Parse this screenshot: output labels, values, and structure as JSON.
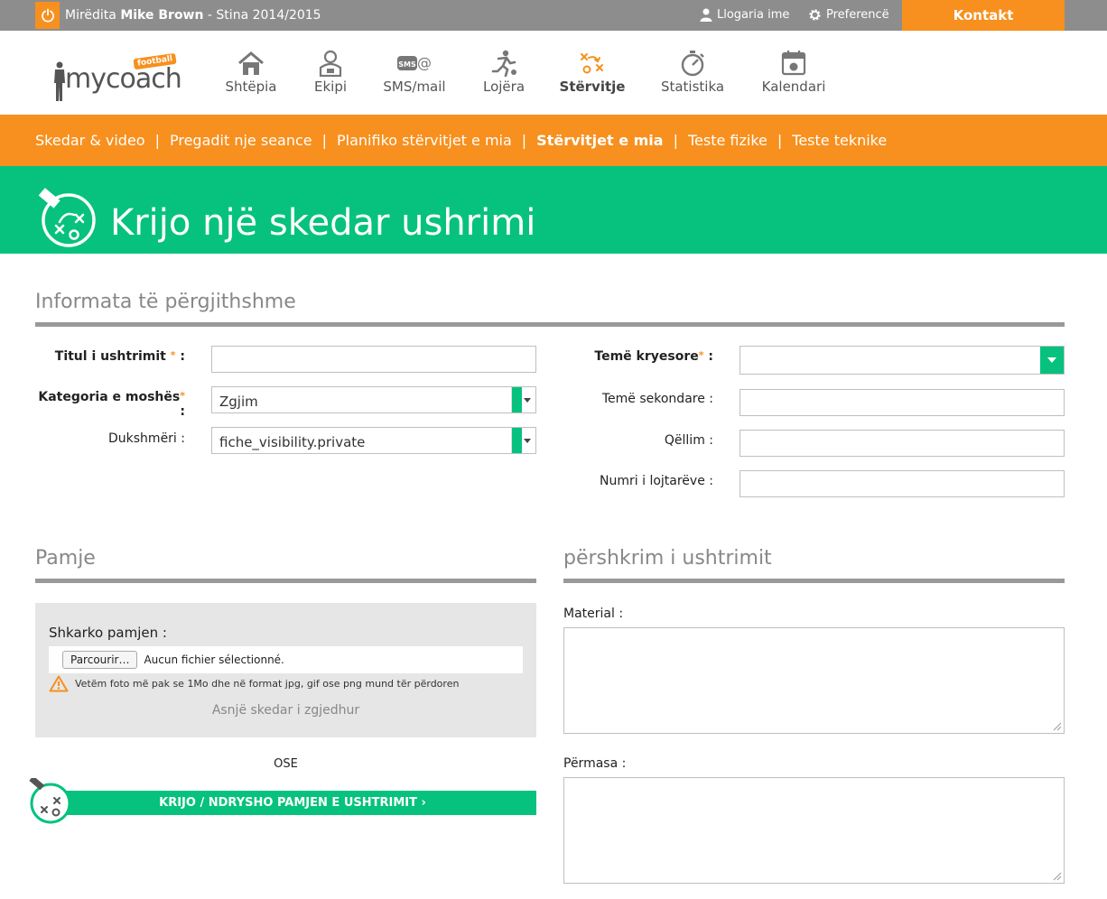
{
  "topbar": {
    "greeting_prefix": "Mirëdita",
    "user_name": "Mike Brown",
    "season": "- Stina 2014/2015",
    "account_label": "Llogaria ime",
    "preferences_label": "Preferencë",
    "contact_label": "Kontakt"
  },
  "logo": {
    "text": "mycoach",
    "badge": "football"
  },
  "nav": {
    "items": [
      {
        "label": "Shtëpia",
        "icon": "home-icon"
      },
      {
        "label": "Ekipi",
        "icon": "team-icon"
      },
      {
        "label": "SMS/mail",
        "icon": "sms-mail-icon"
      },
      {
        "label": "Lojëra",
        "icon": "games-icon"
      },
      {
        "label": "Stërvitje",
        "icon": "training-icon"
      },
      {
        "label": "Statistika",
        "icon": "statistics-icon"
      },
      {
        "label": "Kalendari",
        "icon": "calendar-icon"
      }
    ]
  },
  "subnav": {
    "items": [
      "Skedar & video",
      "Pregadit nje seance",
      "Planifiko stërvitjet e mia",
      "Stërvitjet e mia",
      "Teste fizike",
      "Teste teknike"
    ],
    "separator": "|"
  },
  "hero": {
    "title": "Krijo një skedar ushrimi"
  },
  "general": {
    "title": "Informata të përgjithshme",
    "exercise_title_label": "Titul i ushtrimit",
    "age_category_label": "Kategoria e moshës",
    "visibility_label": "Dukshmëri :",
    "age_category_value": "Zgjim",
    "visibility_value": "fiche_visibility.private",
    "main_theme_label": "Temë kryesore",
    "secondary_theme_label": "Temë sekondare :",
    "goal_label": "Qëllim :",
    "players_label": "Numri i lojtarëve :",
    "required_mark": "*",
    "colon": ":"
  },
  "view": {
    "title": "Pamje",
    "upload_label": "Shkarko pamjen :",
    "browse_label": "Parcourir…",
    "no_file_selected": "Aucun fichier sélectionné.",
    "warning": "Vetëm foto më pak se 1Mo dhe në format jpg, gif ose png mund tër përdoren",
    "no_file_chosen": "Asnjë skedar i zgjedhur",
    "or_label": "OSE",
    "create_button": "KRIJO / NDRYSHO PAMJEN E USHTRIMIT ›"
  },
  "description": {
    "title": "përshkrim i ushtrimit",
    "material_label": "Material :",
    "dimensions_label": "Përmasa :"
  },
  "colors": {
    "orange": "#f7901e",
    "green": "#06c27e",
    "gray": "#8d8d8d"
  }
}
